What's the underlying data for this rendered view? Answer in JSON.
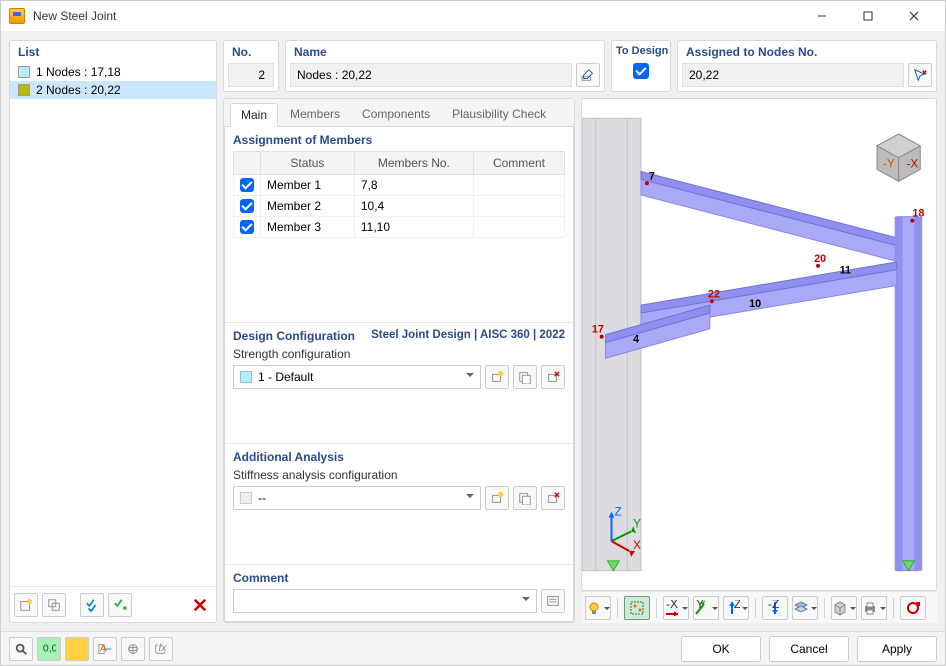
{
  "window": {
    "title": "New Steel Joint"
  },
  "list": {
    "label": "List",
    "items": [
      {
        "idx": "1",
        "label": "1 Nodes : 17,18",
        "color": "#b8ecff",
        "selected": false
      },
      {
        "idx": "2",
        "label": "2 Nodes : 20,22",
        "color": "#b8b800",
        "selected": true
      }
    ]
  },
  "header": {
    "no_label": "No.",
    "no_value": "2",
    "name_label": "Name",
    "name_value": "Nodes : 20,22",
    "todesign_label": "To Design",
    "todesign_checked": true,
    "assigned_label": "Assigned to Nodes No.",
    "assigned_value": "20,22"
  },
  "tabs": {
    "items": [
      "Main",
      "Members",
      "Components",
      "Plausibility Check"
    ],
    "active": 0
  },
  "assignment": {
    "title": "Assignment of Members",
    "cols": [
      "",
      "Status",
      "Members No.",
      "Comment"
    ],
    "rows": [
      {
        "checked": true,
        "status": "Member 1",
        "members": "7,8",
        "comment": ""
      },
      {
        "checked": true,
        "status": "Member 2",
        "members": "10,4",
        "comment": ""
      },
      {
        "checked": true,
        "status": "Member 3",
        "members": "11,10",
        "comment": ""
      }
    ]
  },
  "design_config": {
    "title": "Design Configuration",
    "subtitle": "Steel Joint Design | AISC 360 | 2022",
    "strength_label": "Strength configuration",
    "strength_value": "1 - Default",
    "strength_swatch": "#b8ecff"
  },
  "add_analysis": {
    "title": "Additional Analysis",
    "stiffness_label": "Stiffness analysis configuration",
    "stiffness_value": "--"
  },
  "comment": {
    "title": "Comment",
    "value": ""
  },
  "viewer": {
    "node_labels": [
      "7",
      "18",
      "20",
      "11",
      "22",
      "10",
      "17",
      "4"
    ],
    "axes": [
      "X",
      "Y",
      "Z"
    ]
  },
  "viewer_toolbar": {
    "buttons": [
      "bulb",
      "box-select",
      "axis-x",
      "axis-y",
      "axis-z",
      "axis-neg-z",
      "layers",
      "cube",
      "print",
      "reset"
    ]
  },
  "footer": {
    "ok": "OK",
    "cancel": "Cancel",
    "apply": "Apply"
  }
}
